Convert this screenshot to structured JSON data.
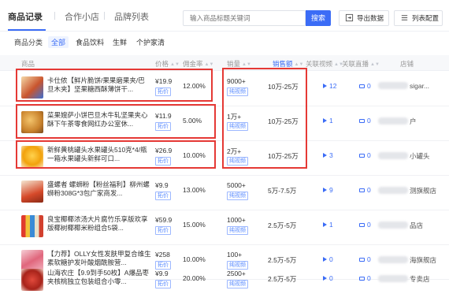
{
  "tabs": [
    {
      "label": "商品记录",
      "active": true
    },
    {
      "label": "合作小店",
      "active": false
    },
    {
      "label": "品牌列表",
      "active": false
    }
  ],
  "search": {
    "placeholder": "输入商品标题关键词",
    "button": "搜索"
  },
  "toolbar": {
    "export_label": "导出数据",
    "columns_label": "列表配置"
  },
  "categories": {
    "title": "商品分类",
    "items": [
      "全部",
      "食品饮料",
      "生鲜",
      "个护家清"
    ],
    "active": "全部"
  },
  "table": {
    "headers": {
      "product": "商品",
      "price": "价格",
      "commission": "佣金率",
      "sales": "销量",
      "gmv": "销售额",
      "videos": "关联视频",
      "lives": "关联直播",
      "shop": "店铺"
    },
    "rows": [
      {
        "name": "卡仕侬【鲜片脆饼/果果磨果夹/巴旦木夹】坚果糖西酥薄饼干...",
        "price": "¥19.9",
        "price_tag": "拓价",
        "commission": "12.00%",
        "sales": "9000+",
        "sales_tag": "纯视频",
        "gmv": "10万-25万",
        "videos": "12",
        "lives": "0",
        "shop": "sigar..."
      },
      {
        "name": "菜果嫂萨小饼巴旦木牛轧坚果夹心酥下午茶零食网红办公室休...",
        "price": "¥11.9",
        "price_tag": "拓价",
        "commission": "5.00%",
        "sales": "1万+",
        "sales_tag": "纯视频",
        "gmv": "10万-25万",
        "videos": "1",
        "lives": "0",
        "shop": "户"
      },
      {
        "name": "新鲜黄桃罐头水果罐头510克*4/瓶一箱水果罐头新鲜可口...",
        "price": "¥26.9",
        "price_tag": "拓价",
        "commission": "10.00%",
        "sales": "2万+",
        "sales_tag": "纯视频",
        "gmv": "10万-25万",
        "videos": "3",
        "lives": "0",
        "shop": "小罐头"
      },
      {
        "name": "盛螺者 螺蛳粉【粉丝福利】柳州螺蛳粉308G*3包广家商发...",
        "price": "¥9.9",
        "price_tag": "拓价",
        "commission": "13.00%",
        "sales": "5000+",
        "sales_tag": "纯视频",
        "gmv": "5万-7.5万",
        "videos": "9",
        "lives": "0",
        "shop": "测旗舰店"
      },
      {
        "name": "良宝椰椰浓汤大片腐竹乐享版欢享版椰树椰椰米粉组合5袋...",
        "price": "¥59.9",
        "price_tag": "拓价",
        "commission": "15.00%",
        "sales": "1000+",
        "sales_tag": "纯视频",
        "gmv": "2.5万-5万",
        "videos": "1",
        "lives": "0",
        "shop": "品店"
      },
      {
        "name": "【力荐】OLLY女性发肤甲复合维生素软糖护发叶酸烟酰胺营...",
        "price": "¥258",
        "price_tag": "拓价",
        "commission": "10.00%",
        "sales": "100+",
        "sales_tag": "纯视频",
        "gmv": "2.5万-5万",
        "videos": "0",
        "lives": "0",
        "shop": "海旗舰店"
      },
      {
        "name": "山海农庄【9.9到手50枚】A爆品枣夹核桃独立包装组合小零...",
        "price": "¥9.9",
        "price_tag": "拓价",
        "commission": "20.00%",
        "sales": "2500+",
        "sales_tag": "纯视频",
        "gmv": "2.5万-5万",
        "videos": "0",
        "lives": "0",
        "shop": "专卖店"
      }
    ]
  },
  "colors": {
    "accent": "#3b6cf6",
    "highlight": "#e53935"
  }
}
